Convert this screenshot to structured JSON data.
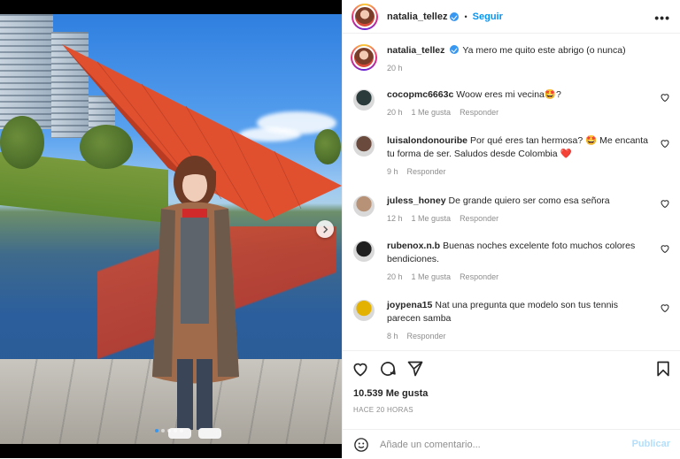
{
  "post": {
    "author": "natalia_tellez",
    "verified": true,
    "follow_label": "Seguir",
    "separator": "•",
    "more_label": "•••",
    "caption": "Ya mero me quito este abrigo (o nunca)",
    "caption_time": "20 h"
  },
  "carousel": {
    "slide_count": 5,
    "active_index": 0
  },
  "comments": [
    {
      "user": "cocopmc6663c",
      "text": "Woow eres mi vecina🤩?",
      "time": "20 h",
      "likes": "1 Me gusta",
      "reply": "Responder",
      "avatar_color": "#2b3a3a"
    },
    {
      "user": "luisalondonouribe",
      "text": "Por qué eres tan hermosa? 🤩 Me encanta tu forma de ser. Saludos desde Colombia ❤️",
      "time": "9 h",
      "likes": "",
      "reply": "Responder",
      "avatar_color": "#6a4a3c"
    },
    {
      "user": "juless_honey",
      "text": "De grande quiero ser como esa señora",
      "time": "12 h",
      "likes": "1 Me gusta",
      "reply": "Responder",
      "avatar_color": "#b79277"
    },
    {
      "user": "rubenox.n.b",
      "text": "Buenas noches excelente foto muchos colores bendiciones.",
      "time": "20 h",
      "likes": "1 Me gusta",
      "reply": "Responder",
      "avatar_color": "#1f1f1f"
    },
    {
      "user": "joypena15",
      "text": "Nat una pregunta que modelo son tus tennis parecen samba",
      "time": "8 h",
      "likes": "",
      "reply": "Responder",
      "avatar_color": "#e3b200"
    }
  ],
  "actions": {
    "likes_label": "10.539 Me gusta",
    "posted_ago": "HACE 20 HORAS",
    "comment_placeholder": "Añade un comentario...",
    "publish_label": "Publicar"
  },
  "colors": {
    "accent": "#0095f6",
    "publish_disabled": "#b2dffc",
    "muted": "#8e8e8e",
    "text": "#262626"
  },
  "icons": [
    "chevron-right-icon",
    "verified-badge-icon",
    "more-options-icon",
    "heart-icon",
    "comment-icon",
    "share-icon",
    "bookmark-icon",
    "emoji-icon"
  ]
}
